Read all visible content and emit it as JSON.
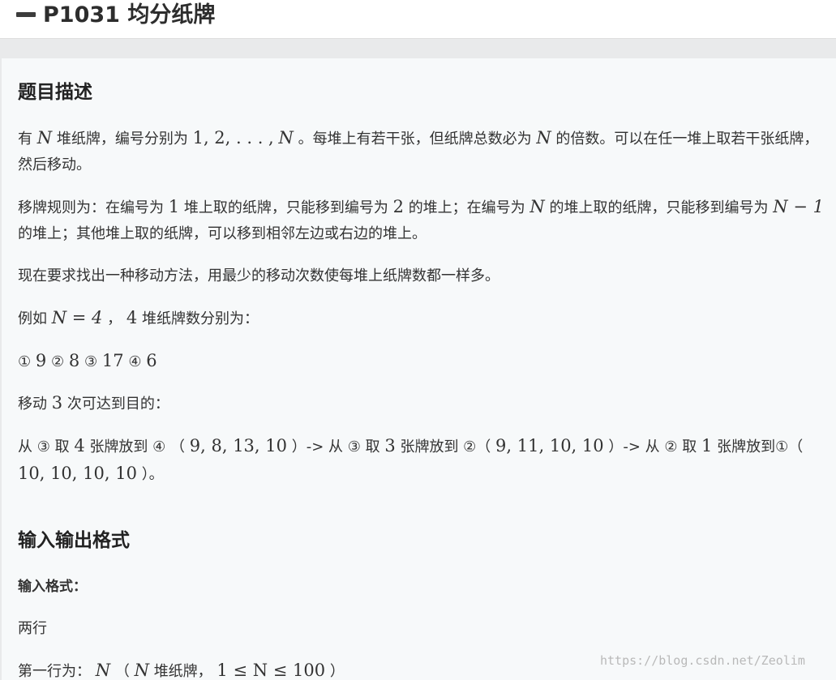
{
  "header": {
    "title": "P1031 均分纸牌"
  },
  "section_description": {
    "heading": "题目描述",
    "p1": {
      "a": "有",
      "N1": "N",
      "b": "堆纸牌，编号分别为",
      "seq": "1, 2, . . . ,",
      "N2": "N",
      "c": "。每堆上有若干张，但纸牌总数必为",
      "N3": "N",
      "d": "的倍数。可以在任一堆上取若干张纸牌，然后移动。"
    },
    "p2": {
      "a": "移牌规则为：在编号为",
      "one": "1",
      "b": "堆上取的纸牌，只能移到编号为",
      "two": "2",
      "c": "的堆上；在编号为",
      "N": "N",
      "d": "的堆上取的纸牌，只能移到编号为",
      "Nm1": "N − 1",
      "e": "的堆上；其他堆上取的纸牌，可以移到相邻左边或右边的堆上。"
    },
    "p3": "现在要求找出一种移动方法，用最少的移动次数使每堆上纸牌数都一样多。",
    "p4": {
      "a": "例如",
      "eq": "N = 4",
      "b": "，",
      "four": "4",
      "c": "堆纸牌数分别为："
    },
    "p5": {
      "c1": "①",
      "v1": "9",
      "c2": "②",
      "v2": "8",
      "c3": "③",
      "v3": "17",
      "c4": "④",
      "v4": "6"
    },
    "p6": {
      "a": "移动",
      "three": "3",
      "b": "次可达到目的："
    },
    "p7": {
      "a": "从 ③ 取",
      "n1": "4",
      "b": "张牌放到 ④ （",
      "t1": "9, 8, 13, 10",
      "c": "）-> 从 ③ 取",
      "n2": "3",
      "d": "张牌放到 ②（",
      "t2": "9, 11, 10, 10",
      "e": "）-> 从 ② 取",
      "n3": "1",
      "f": "张牌放到①（",
      "t3": "10, 10, 10, 10",
      "g": "）。"
    }
  },
  "section_io": {
    "heading": "输入输出格式",
    "input_label": "输入格式：",
    "line1": "两行",
    "line2": {
      "a": "第一行为：",
      "N1": "N",
      "b": "（",
      "N2": "N",
      "c": "堆纸牌，",
      "range": "1 ≤ N ≤ 100",
      "d": "）"
    }
  },
  "watermark": "https://blog.csdn.net/Zeolim"
}
